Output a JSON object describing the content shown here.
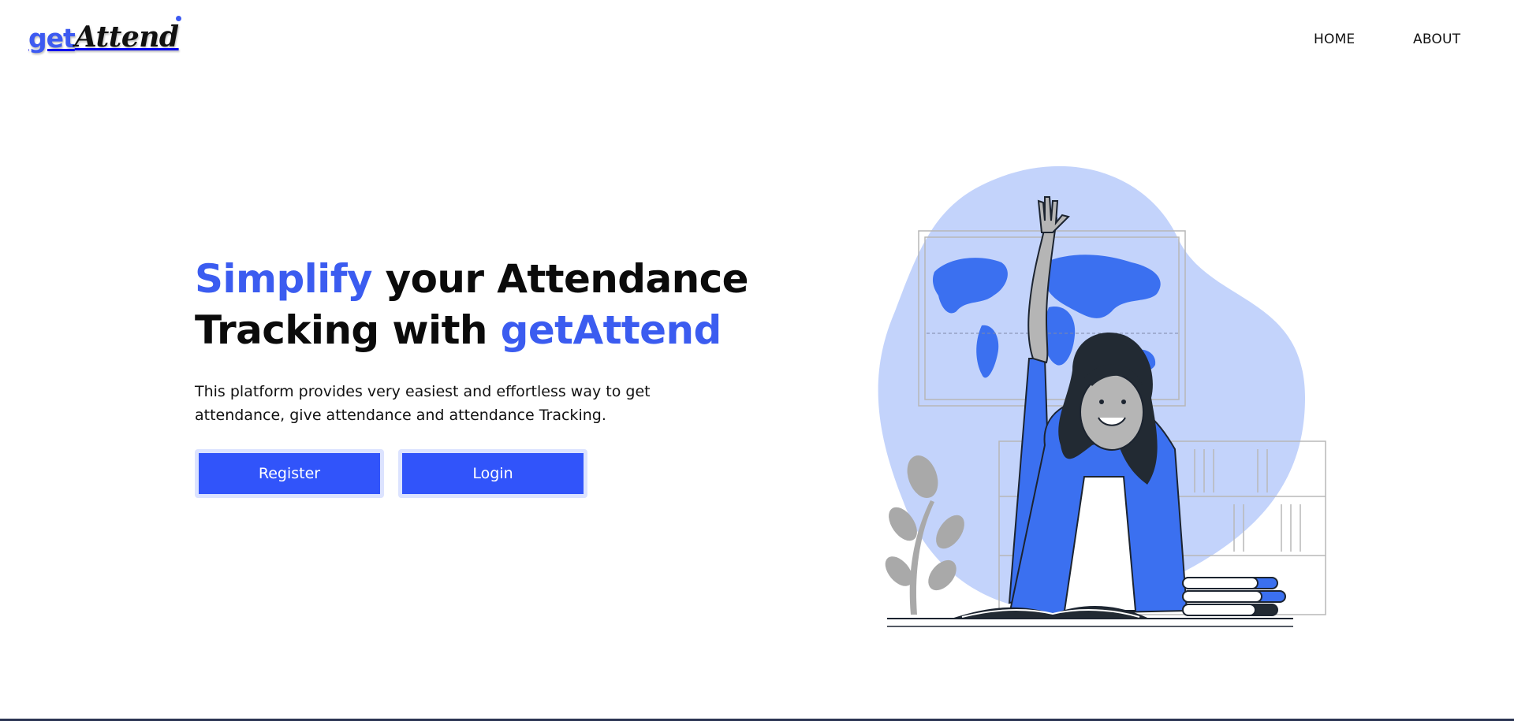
{
  "brand": {
    "logo_get": "get",
    "logo_attend": "Attend",
    "accent_color": "#3b5cf0"
  },
  "nav": {
    "home": "HOME",
    "about": "ABOUT"
  },
  "hero": {
    "headline_part1_accent": "Simplify",
    "headline_part2": " your Attendance",
    "headline_part3": "Tracking with ",
    "headline_part4_accent": "getAttend",
    "description": "This platform provides very easiest and effortless way to get attendance, give attendance and attendance Tracking."
  },
  "buttons": {
    "register": "Register",
    "login": "Login",
    "color": "#3154fa"
  },
  "illustration": {
    "name": "student-raising-hand-illustration"
  }
}
